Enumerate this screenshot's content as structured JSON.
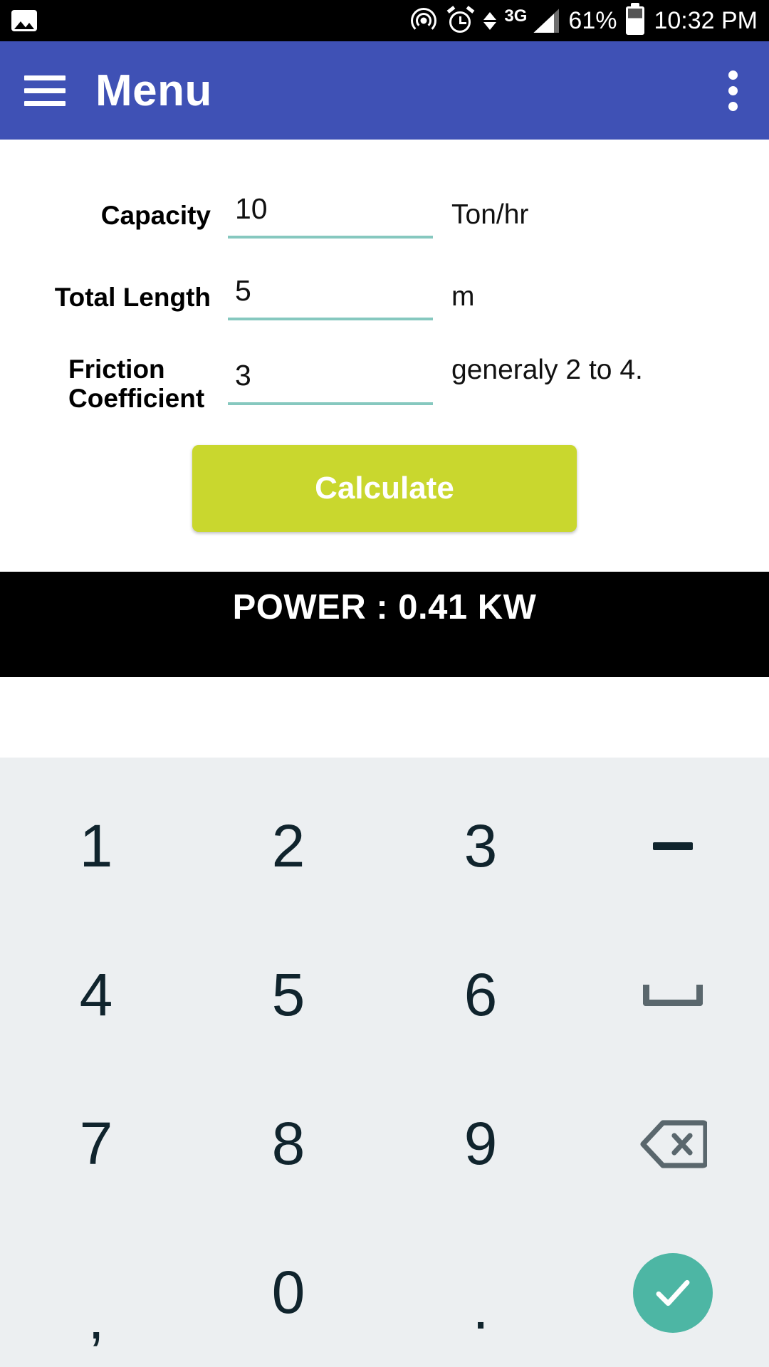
{
  "status_bar": {
    "icons": [
      "photo-icon",
      "cast-icon",
      "alarm-icon",
      "data-transfer-icon",
      "signal-icon"
    ],
    "network_type": "3G",
    "battery_percent": "61%",
    "time": "10:32 PM"
  },
  "appbar": {
    "menu_icon": "hamburger-icon",
    "title": "Menu",
    "overflow_icon": "more-vertical-icon",
    "background": "#3f51b5"
  },
  "form": {
    "fields": [
      {
        "label": "Capacity",
        "value": "10",
        "unit": "Ton/hr"
      },
      {
        "label": "Total Length",
        "value": "5",
        "unit": "m"
      },
      {
        "label": "Friction Coefficient",
        "value": "3",
        "unit": "generaly 2 to 4."
      }
    ],
    "underline_color": "#86c8bf"
  },
  "calculate": {
    "label": "Calculate",
    "background": "#c9d72e",
    "text_color": "#ffffff"
  },
  "result": {
    "text": "POWER : 0.41 KW",
    "background": "#000000",
    "text_color": "#ffffff"
  },
  "keyboard": {
    "background": "#eceff1",
    "key_color": "#10242d",
    "enter_color": "#4db6a4",
    "rows": [
      [
        {
          "label": "1",
          "name": "key-1"
        },
        {
          "label": "2",
          "name": "key-2"
        },
        {
          "label": "3",
          "name": "key-3"
        },
        {
          "label": "−",
          "name": "key-minus"
        }
      ],
      [
        {
          "label": "4",
          "name": "key-4"
        },
        {
          "label": "5",
          "name": "key-5"
        },
        {
          "label": "6",
          "name": "key-6"
        },
        {
          "label": "space",
          "name": "key-space"
        }
      ],
      [
        {
          "label": "7",
          "name": "key-7"
        },
        {
          "label": "8",
          "name": "key-8"
        },
        {
          "label": "9",
          "name": "key-9"
        },
        {
          "label": "backspace",
          "name": "key-backspace"
        }
      ],
      [
        {
          "label": ",",
          "name": "key-comma"
        },
        {
          "label": "0",
          "name": "key-0"
        },
        {
          "label": ".",
          "name": "key-period"
        },
        {
          "label": "enter",
          "name": "key-enter"
        }
      ]
    ]
  }
}
